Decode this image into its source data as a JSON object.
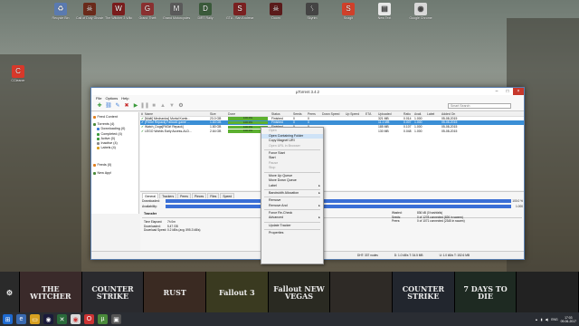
{
  "desktop": {
    "icons": [
      {
        "label": "Recycle Bin",
        "icon": "recycle-bin-icon",
        "color": "#5a7ab0",
        "glyph": "♻"
      },
      {
        "label": "Call of Duty Ghosts",
        "icon": "cod-icon",
        "color": "#6a2a1a",
        "glyph": "☠"
      },
      {
        "label": "The Witcher 3 Wild Hunt",
        "icon": "witcher-icon",
        "color": "#7a1c1c",
        "glyph": "W"
      },
      {
        "label": "Grand Theft",
        "icon": "gta-icon",
        "color": "#8a3030",
        "glyph": "G"
      },
      {
        "label": "Grand Motorcycles",
        "icon": "game-icon",
        "color": "#5a5a5a",
        "glyph": "M"
      },
      {
        "label": "DiRT Rally",
        "icon": "dirt-icon",
        "color": "#3a5a3a",
        "glyph": "D"
      },
      {
        "label": "GTA - San Andreas",
        "icon": "gta-sa-icon",
        "color": "#7a2020",
        "glyph": "S"
      },
      {
        "label": "Doom",
        "icon": "doom-icon",
        "color": "#5a1a1a",
        "glyph": "☠"
      },
      {
        "label": "Skyrim",
        "icon": "skyrim-icon",
        "color": "#444",
        "glyph": "ᛊ"
      },
      {
        "label": "Snagit",
        "icon": "snagit-icon",
        "color": "#d0402a",
        "glyph": "S"
      },
      {
        "label": "New Text",
        "icon": "text-file-icon",
        "color": "#e8e8e8",
        "glyph": "▤"
      },
      {
        "label": "Google Chrome",
        "icon": "chrome-icon",
        "color": "#d8d8d8",
        "glyph": "◉"
      },
      {
        "label": "CCleaner",
        "icon": "ccleaner-icon",
        "color": "#d8382a",
        "glyph": "C"
      }
    ]
  },
  "window": {
    "title": "µTorrent 3.4.2",
    "menu": [
      "File",
      "Options",
      "Help"
    ],
    "search_placeholder": "Smart Search"
  },
  "sidebar": {
    "items": [
      {
        "label": "Torrents (4)",
        "color": "#4a8a3a"
      },
      {
        "label": "Downloading (0)",
        "color": "#3a7ad6"
      },
      {
        "label": "Completed (4)",
        "color": "#3a9a3a"
      },
      {
        "label": "Active (0)",
        "color": "#3a9a3a"
      },
      {
        "label": "Inactive (4)",
        "color": "#888"
      },
      {
        "label": "Labels (4)",
        "color": "#d8a020"
      },
      {
        "label": "Feeds (0)",
        "color": "#e08020"
      },
      {
        "label": "New App!",
        "color": "#4a8a3a"
      }
    ],
    "top_label": "Feed Content"
  },
  "grid": {
    "columns": [
      "#",
      "Name",
      "Size",
      "Done",
      "Status",
      "Seeds",
      "Peers",
      "Down Speed",
      "Up Speed",
      "ETA",
      "Uploaded",
      "Ratio",
      "Avail.",
      "Label",
      "Added On"
    ],
    "rows": [
      {
        "name": "[Multi] Mechanics] Mortal Komb...",
        "size": "23.0 GB",
        "done": 1.0,
        "done_label": "100.0%",
        "status": "Finished",
        "seeds": "0",
        "peers": "0",
        "uploaded": "321 MB",
        "ratio": "0.014",
        "avail": "1.000",
        "added": "05-08-2015"
      },
      {
        "name": "[FitGirl Repack] Fallout4 game ...",
        "size": "1.83 GB",
        "done": 1.0,
        "done_label": "100.0%",
        "status": "Finished",
        "seeds": "0",
        "peers": "0",
        "uploaded": "11.1 MB",
        "ratio": "0.007",
        "avail": "1.000",
        "added": "05-08-2015",
        "selected": true
      },
      {
        "name": "Watch_Dogs[FitGirl Repack]",
        "size": "1.80 GB",
        "done": 1.0,
        "done_label": "100.0%",
        "status": "Finished",
        "seeds": "0",
        "peers": "0",
        "uploaded": "185 MB",
        "ratio": "0.107",
        "avail": "1.000",
        "added": "05-08-2015"
      },
      {
        "name": "LEGO Worlds Early Access-ALD...",
        "size": "2.64 GB",
        "done": 1.0,
        "done_label": "100.0%",
        "status": "Finished",
        "seeds": "0",
        "peers": "0",
        "uploaded": "130 MB",
        "ratio": "0.048",
        "avail": "1.000",
        "added": "05-08-2015"
      }
    ]
  },
  "context_menu": {
    "items": [
      {
        "label": "Open",
        "disabled": true
      },
      {
        "label": "Open Containing Folder",
        "highlight": true
      },
      {
        "label": "Copy Magnet URI"
      },
      {
        "label": "Open URL in Browser",
        "disabled": true
      },
      {
        "sep": true
      },
      {
        "label": "Force Start"
      },
      {
        "label": "Start"
      },
      {
        "label": "Pause",
        "disabled": true
      },
      {
        "label": "Stop",
        "disabled": true
      },
      {
        "sep": true
      },
      {
        "label": "Move Up Queue"
      },
      {
        "label": "Move Down Queue"
      },
      {
        "label": "Label",
        "submenu": true
      },
      {
        "sep": true
      },
      {
        "label": "Bandwidth Allocation",
        "submenu": true
      },
      {
        "sep": true
      },
      {
        "label": "Remove"
      },
      {
        "label": "Remove And",
        "submenu": true
      },
      {
        "sep": true
      },
      {
        "label": "Force Re-Check"
      },
      {
        "label": "Advanced",
        "submenu": true
      },
      {
        "sep": true
      },
      {
        "label": "Update Tracker"
      },
      {
        "sep": true
      },
      {
        "label": "Properties"
      }
    ]
  },
  "panel": {
    "tabs": [
      "General",
      "Trackers",
      "Peers",
      "Pieces",
      "Files",
      "Speed"
    ],
    "downloaded_label": "Downloaded:",
    "availability_label": "Availability:",
    "downloaded_value": "100.0 %",
    "availability_value": "1.000",
    "transfer_label": "Transfer",
    "left_info": [
      "Time Elapsed:",
      "Downloaded:",
      "Download Speed:"
    ],
    "left_values": [
      "7h 0m",
      "5.47 GB",
      "0.2 kB/s (avg. 595.3 kB/s)"
    ],
    "right_info": [
      "Wasted:",
      "Seeds:",
      "Peers:"
    ],
    "right_values": [
      "836 kB (0 hashfails)",
      "0 of 1278 connected (826 in swarm)",
      "0 of 1071 connected (2345 in swarm)"
    ]
  },
  "status": {
    "dht": "DHT: 337 nodes",
    "down": "D: 1.0 kB/s T: 34.5 MB",
    "up": "U: 1.0 kB/s T: 152.6 MB"
  },
  "games": [
    "",
    "THE WITCHER",
    "COUNTER STRIKE",
    "RUST",
    "Fallout 3",
    "Fallout NEW VEGAS",
    "",
    "COUNTER STRIKE",
    "7 DAYS TO DIE",
    ""
  ],
  "tray": {
    "lang": "ENG",
    "time": "17:03",
    "date": "09-06-2017"
  }
}
